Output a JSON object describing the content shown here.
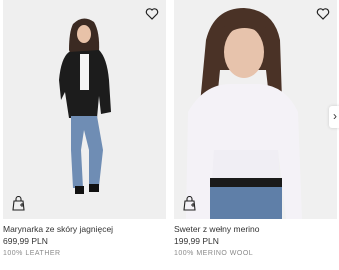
{
  "products": [
    {
      "name": "Marynarka ze skóry jagnięcej",
      "price": "699,99 PLN",
      "material": "100% LEATHER",
      "icons": {
        "favorite": "heart-icon",
        "bag": "shopping-bag-icon"
      }
    },
    {
      "name": "Sweter z wełny merino",
      "price": "199,99 PLN",
      "material": "100% MERINO WOOL",
      "icons": {
        "favorite": "heart-icon",
        "bag": "shopping-bag-icon"
      }
    }
  ],
  "navigation": {
    "next_icon": "chevron-right-icon",
    "next_symbol": "›"
  },
  "colors": {
    "background": "#ffffff",
    "photo_bg": "#eeeeee",
    "text": "#333333",
    "muted": "#8a8a8a"
  }
}
